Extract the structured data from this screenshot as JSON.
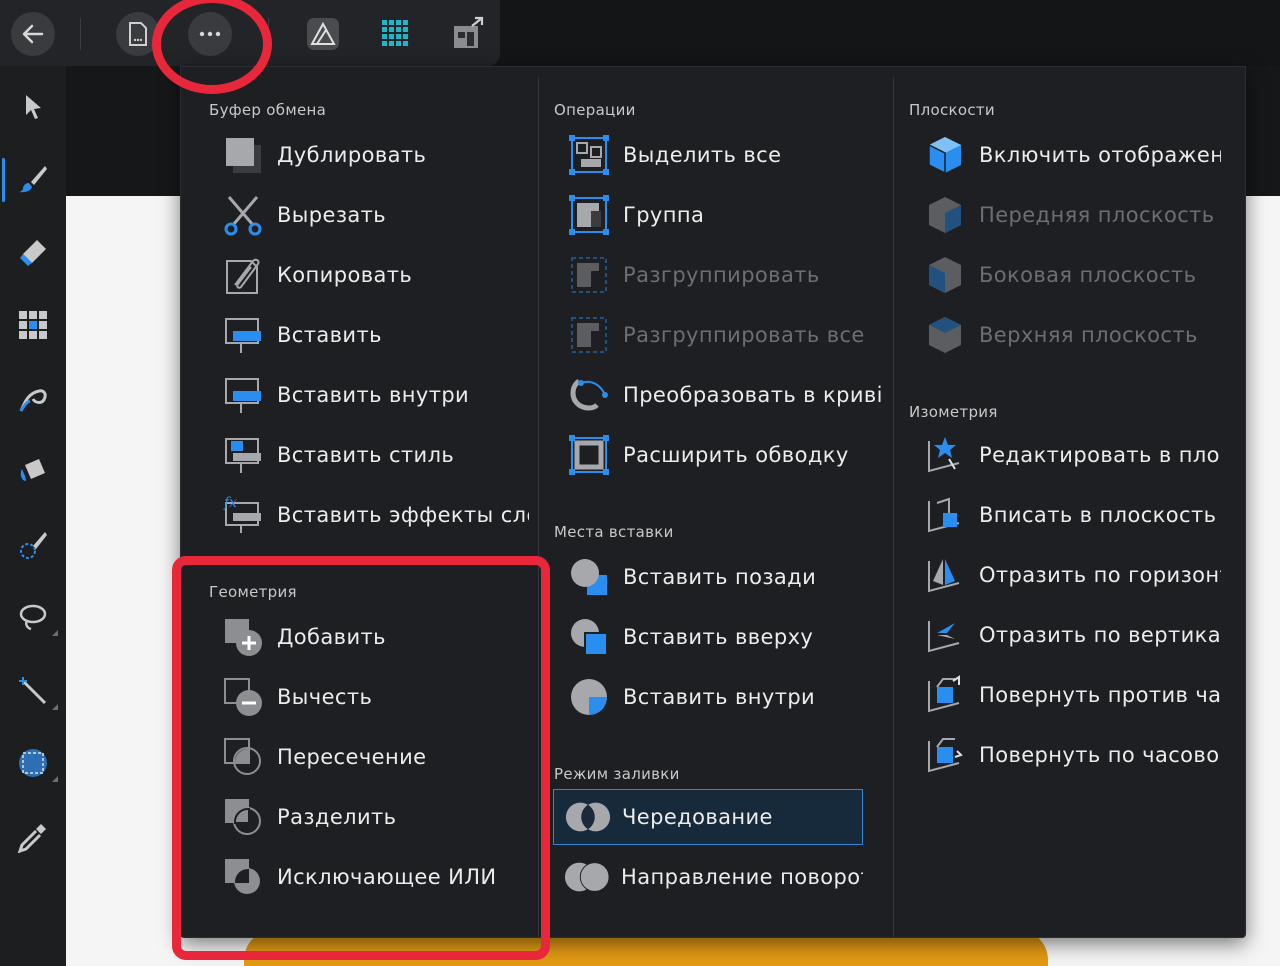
{
  "colors": {
    "accent": "#2a8ef0",
    "annotation": "#e8283a",
    "fill_orange": "#e39b14"
  },
  "top_toolbar": {
    "icons": [
      "back-arrow-icon",
      "document-icon",
      "more-icon",
      "affinity-logo-icon",
      "dots-grid-icon",
      "export-icon"
    ]
  },
  "left_tools": [
    "move-tool-icon",
    "brush-icon",
    "eraser-icon",
    "grid-icon",
    "smudge-icon",
    "fill-bucket-icon",
    "selection-brush-icon",
    "lasso-icon",
    "magic-wand-icon",
    "marquee-icon",
    "color-picker-icon"
  ],
  "menu": {
    "clipboard": {
      "title": "Буфер обмена",
      "items": [
        {
          "label": "Дублировать",
          "icon": "duplicate-icon"
        },
        {
          "label": "Вырезать",
          "icon": "scissors-icon"
        },
        {
          "label": "Копировать",
          "icon": "copy-icon"
        },
        {
          "label": "Вставить",
          "icon": "paste-icon"
        },
        {
          "label": "Вставить внутри",
          "icon": "paste-inside-icon"
        },
        {
          "label": "Вставить стиль",
          "icon": "paste-style-icon"
        },
        {
          "label": "Вставить эффекты сло",
          "icon": "paste-fx-icon"
        }
      ]
    },
    "geometry": {
      "title": "Геометрия",
      "items": [
        {
          "label": "Добавить",
          "icon": "add-shape-icon"
        },
        {
          "label": "Вычесть",
          "icon": "subtract-shape-icon"
        },
        {
          "label": "Пересечение",
          "icon": "intersect-shape-icon"
        },
        {
          "label": "Разделить",
          "icon": "divide-shape-icon"
        },
        {
          "label": "Исключающее ИЛИ",
          "icon": "xor-shape-icon"
        }
      ]
    },
    "operations": {
      "title": "Операции",
      "items": [
        {
          "label": "Выделить все",
          "icon": "select-all-icon"
        },
        {
          "label": "Группа",
          "icon": "group-icon"
        },
        {
          "label": "Разгруппировать",
          "icon": "ungroup-icon",
          "disabled": true
        },
        {
          "label": "Разгруппировать все",
          "icon": "ungroup-all-icon",
          "disabled": true
        },
        {
          "label": "Преобразовать в криві",
          "icon": "convert-to-curves-icon"
        },
        {
          "label": "Расширить обводку",
          "icon": "expand-stroke-icon"
        }
      ]
    },
    "paste_places": {
      "title": "Места вставки",
      "items": [
        {
          "label": "Вставить позади",
          "icon": "insert-behind-icon"
        },
        {
          "label": "Вставить вверху",
          "icon": "insert-on-top-icon"
        },
        {
          "label": "Вставить внутри",
          "icon": "insert-inside-icon"
        }
      ]
    },
    "fill_mode": {
      "title": "Режим заливки",
      "items": [
        {
          "label": "Чередование",
          "icon": "alternate-fill-icon",
          "selected": true
        },
        {
          "label": "Направление поворота",
          "icon": "winding-fill-icon"
        }
      ]
    },
    "planes": {
      "title": "Плоскости",
      "items": [
        {
          "label": "Включить отображение",
          "icon": "planes-cube-icon"
        },
        {
          "label": "Передняя плоскость",
          "icon": "front-plane-icon",
          "disabled": true
        },
        {
          "label": "Боковая плоскость",
          "icon": "side-plane-icon",
          "disabled": true
        },
        {
          "label": "Верхняя плоскость",
          "icon": "top-plane-icon",
          "disabled": true
        }
      ]
    },
    "isometry": {
      "title": "Изометрия",
      "items": [
        {
          "label": "Редактировать в плоск",
          "icon": "edit-in-plane-icon"
        },
        {
          "label": "Вписать в плоскость",
          "icon": "fit-to-plane-icon"
        },
        {
          "label": "Отразить по горизонта",
          "icon": "flip-horizontal-icon"
        },
        {
          "label": "Отразить по вертикалі",
          "icon": "flip-vertical-icon"
        },
        {
          "label": "Повернуть против часс",
          "icon": "rotate-ccw-icon"
        },
        {
          "label": "Повернуть по часовой",
          "icon": "rotate-cw-icon"
        }
      ]
    }
  }
}
